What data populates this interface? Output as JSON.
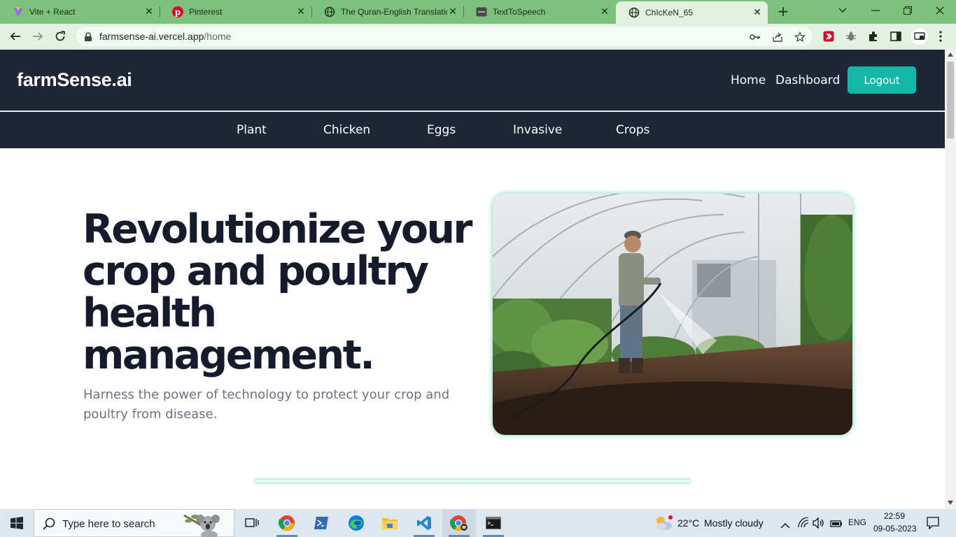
{
  "browser": {
    "tabs": [
      {
        "title": "Vite + React",
        "icon": "vite-icon"
      },
      {
        "title": "Pinterest",
        "icon": "pinterest-icon"
      },
      {
        "title": "The Quran-English Translatio",
        "icon": "globe-icon"
      },
      {
        "title": "TextToSpeech",
        "icon": "terminal-favicon-icon"
      },
      {
        "title": "ChIcKeN_65",
        "icon": "globe-icon",
        "active": true
      }
    ],
    "url_host": "farmsense-ai.vercel.app",
    "url_path": "/home",
    "colors": {
      "frame": "#7cc17c",
      "toolbar": "#e3f1e3"
    }
  },
  "site": {
    "brand": "farmSense.ai",
    "nav": {
      "home": "Home",
      "dashboard": "Dashboard",
      "logout": "Logout"
    },
    "subnav": [
      "Plant",
      "Chicken",
      "Eggs",
      "Invasive",
      "Crops"
    ],
    "hero": {
      "title_lines": [
        "Revolutionize your",
        "crop and poultry",
        "health",
        "management."
      ],
      "subtitle": "Harness the power of technology to protect your crop and poultry from disease.",
      "image": "greenhouse-farmer-watering-photo"
    },
    "colors": {
      "header_bg": "#1e2637",
      "accent": "#14b8a6",
      "title": "#141b2d",
      "subtitle": "#6b7280"
    }
  },
  "taskbar": {
    "search_placeholder": "Type here to search",
    "apps": [
      "task-view-icon",
      "chrome-icon",
      "powershell-icon",
      "edge-icon",
      "file-explorer-icon",
      "vscode-icon",
      "chrome-profile-icon",
      "terminal-icon"
    ],
    "weather": {
      "temp": "22°C",
      "condition": "Mostly cloudy"
    },
    "language": "ENG",
    "time": "22:59",
    "date": "09-05-2023"
  }
}
